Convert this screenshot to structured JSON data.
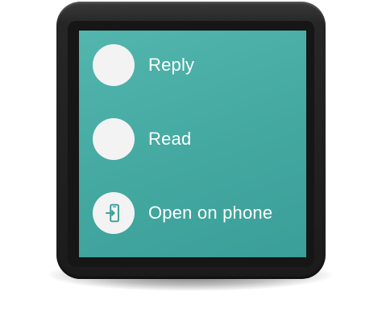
{
  "screen": {
    "background_color": "#46aba3",
    "actions": [
      {
        "label": "Reply",
        "icon": "blank-circle-icon"
      },
      {
        "label": "Read",
        "icon": "blank-circle-icon"
      },
      {
        "label": "Open on phone",
        "icon": "open-on-phone-icon"
      }
    ]
  },
  "colors": {
    "accent_teal": "#46aba3",
    "icon_background": "#f3f3f3",
    "icon_glyph": "#3a9f98",
    "text": "#ffffff",
    "watch_body": "#222222"
  }
}
